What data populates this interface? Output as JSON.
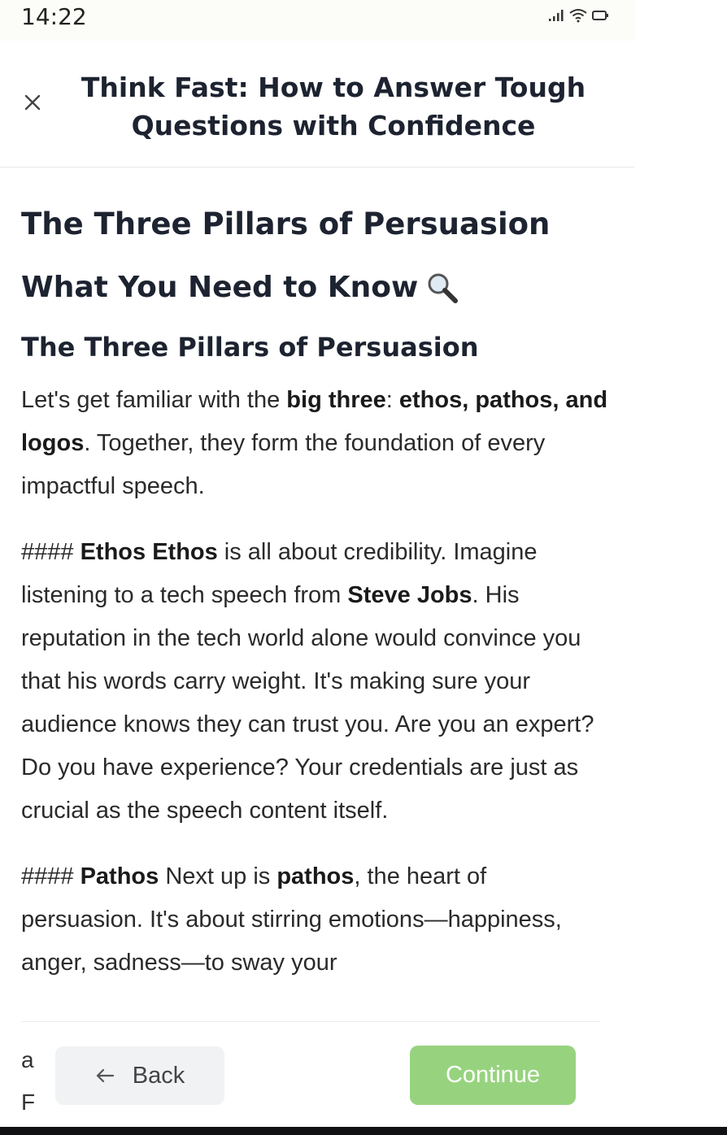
{
  "status_bar": {
    "time": "14:22"
  },
  "header": {
    "title": "Think Fast: How to Answer Tough Questions with Confidence"
  },
  "content": {
    "heading1": "The Three Pillars of Persuasion",
    "heading2": "What You Need to Know",
    "heading2_emoji": "🔍",
    "heading3": "The Three Pillars of Persuasion",
    "intro": {
      "t1": "Let's get familiar with the ",
      "b1": "big three",
      "t2": ": ",
      "b2": "ethos, pathos, and logos",
      "t3": ". Together, they form the foundation of every impactful speech."
    },
    "ethos": {
      "hashes": "#### ",
      "b1": "Ethos Ethos",
      "t1": " is all about credibility. Imagine listening to a tech speech from ",
      "b2": "Steve Jobs",
      "t2": ". His reputation in the tech world alone would convince you that his words carry weight. It's making sure your audience knows they can trust you. Are you an expert? Do you have experience? Your credentials are just as crucial as the speech content itself."
    },
    "pathos": {
      "hashes": "#### ",
      "b1": "Pathos",
      "t1": " Next up is ",
      "b2": "pathos",
      "t2": ", the heart of persuasion. It's about stirring emotions—happiness, anger, sadness—to sway your"
    },
    "cut_line_a": "a",
    "cut_line_h": "F"
  },
  "footer": {
    "back_label": "Back",
    "continue_label": "Continue"
  },
  "colors": {
    "continue_bg": "#97d37f",
    "back_bg": "#f1f2f4",
    "title": "#1d2330"
  },
  "icons": {
    "close": "close-icon",
    "back_arrow": "arrow-left-icon",
    "search": "magnifier-icon"
  }
}
